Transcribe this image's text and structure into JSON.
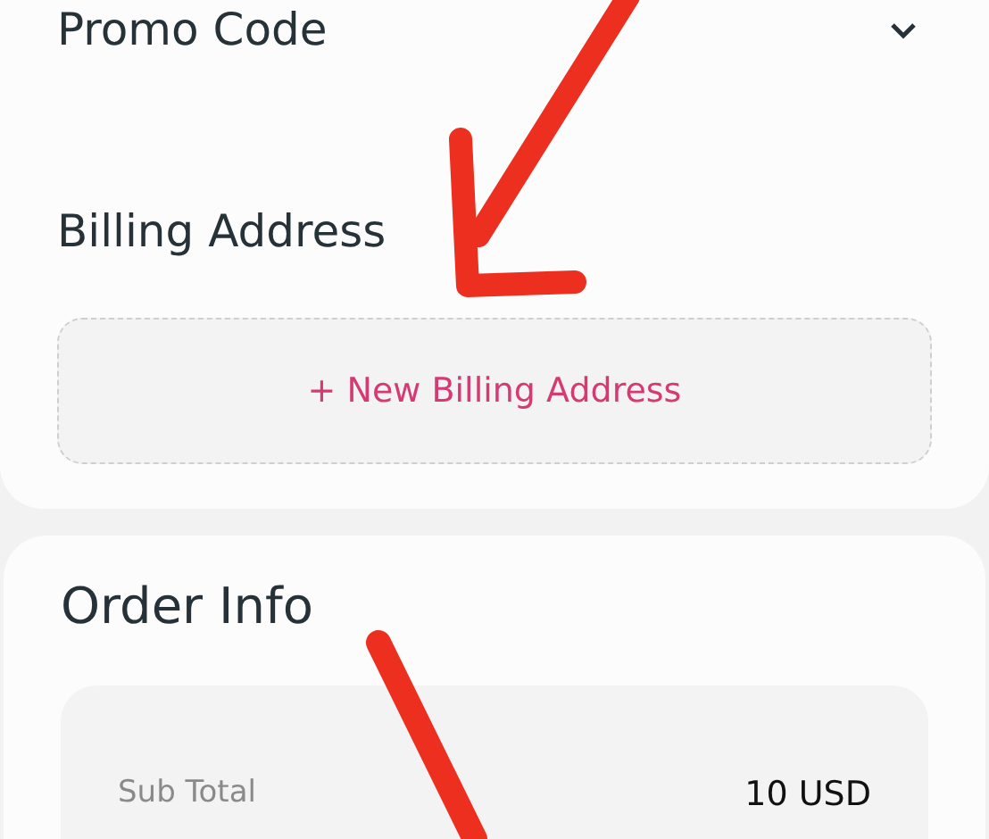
{
  "promo_code": {
    "label": "Promo Code",
    "expanded": false
  },
  "billing_address": {
    "title": "Billing Address",
    "add_button": "+ New Billing Address"
  },
  "order_info": {
    "title": "Order Info",
    "rows": [
      {
        "label": "Sub Total",
        "value": "10 USD"
      }
    ]
  }
}
